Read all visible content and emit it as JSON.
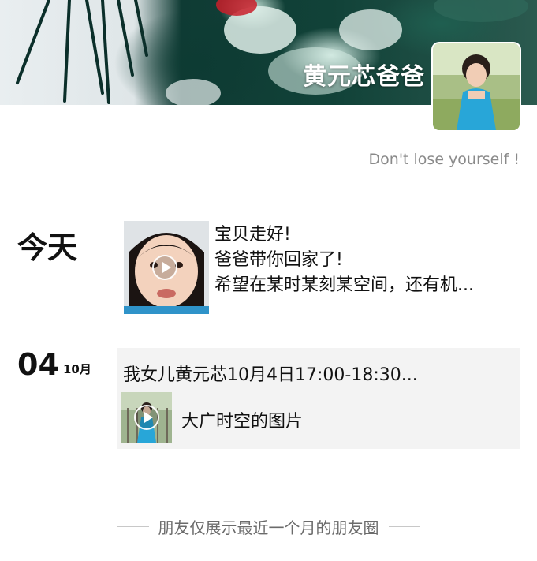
{
  "profile": {
    "name": "黄元芯爸爸",
    "signature": "Don't lose yourself !"
  },
  "timeline": {
    "today": {
      "label": "今天",
      "post": {
        "type": "video",
        "lines": [
          "宝贝走好!",
          "爸爸带你回家了!",
          "希望在某时某刻某空间，还有机..."
        ]
      }
    },
    "oct4": {
      "day": "04",
      "month": "10月",
      "post": {
        "text": "我女儿黄元芯10月4日17:00-18:30...",
        "link_title": "大广时空的图片"
      }
    }
  },
  "footer": {
    "text": "朋友仅展示最近一个月的朋友圈"
  },
  "icons": [
    "play-icon"
  ],
  "colors": {
    "cover_dark": "#0f3b34",
    "post_box_bg": "#f3f3f3",
    "muted_text": "#8a8a8a"
  }
}
